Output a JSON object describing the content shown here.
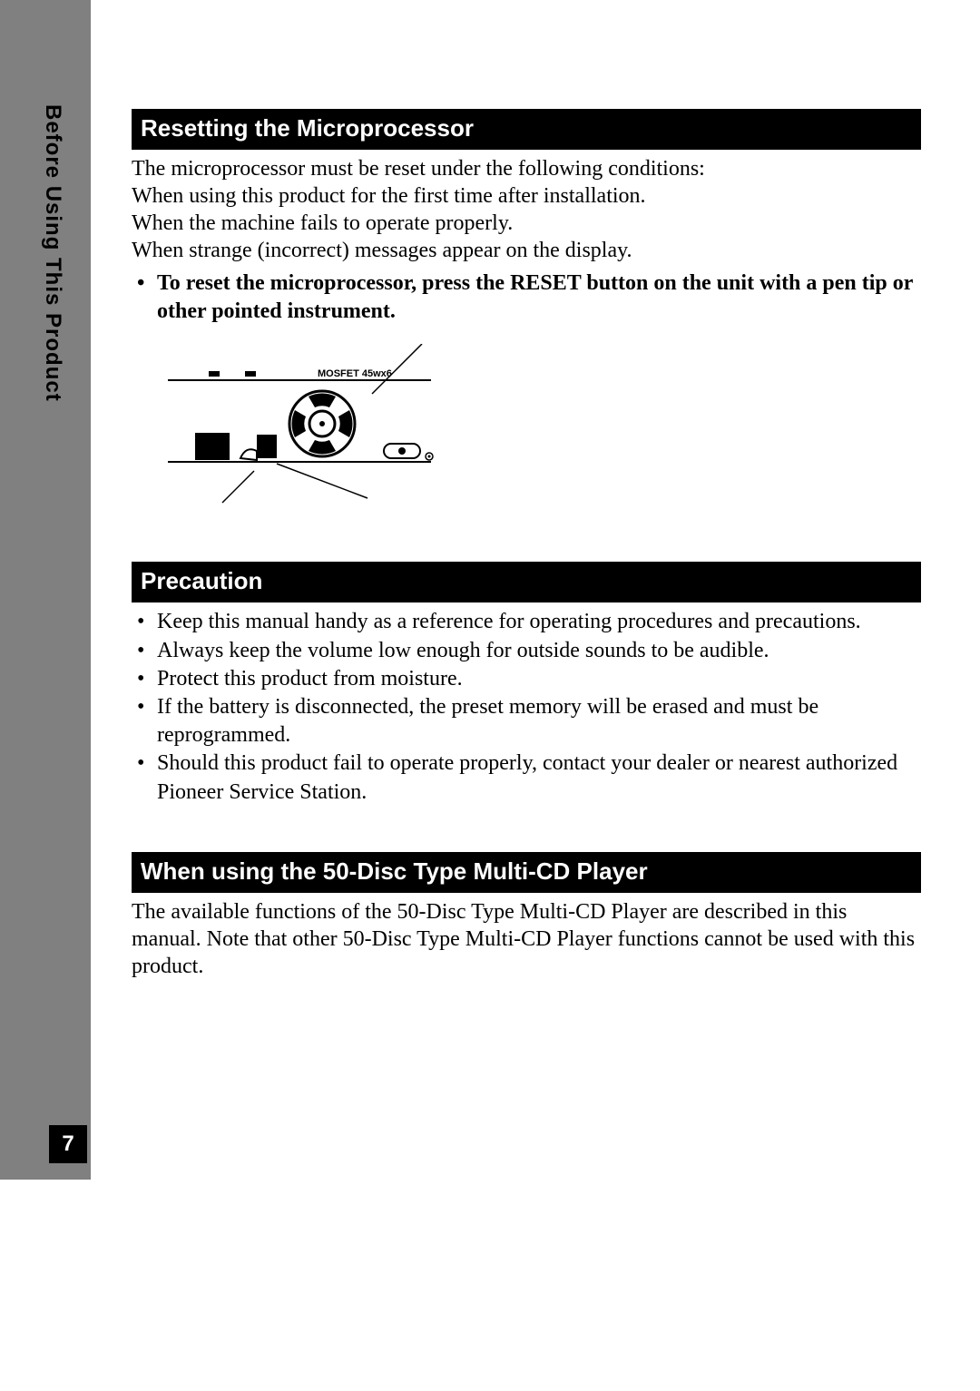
{
  "sidebar": {
    "section_label": "Before Using This Product",
    "page_number": "7"
  },
  "section1": {
    "heading": "Resetting the Microprocessor",
    "paragraph_lines": [
      "The microprocessor must be reset under the following conditions:",
      "When using this product for the first time after installation.",
      "When the machine fails to operate properly.",
      "When strange (incorrect) messages appear on the display."
    ],
    "instruction": "To reset the microprocessor, press the RESET button on the unit with a pen tip or other pointed instrument.",
    "figure_label": "MOSFET 45wx6"
  },
  "section2": {
    "heading": "Precaution",
    "bullets": [
      "Keep this manual handy as a reference for operating procedures and precautions.",
      "Always keep the volume low enough for outside sounds to be audible.",
      "Protect this product from moisture.",
      "If the battery is disconnected, the preset memory will be erased and must be reprogrammed.",
      "Should this product fail to operate properly, contact your dealer or nearest authorized Pioneer Service Station."
    ]
  },
  "section3": {
    "heading": "When using the 50-Disc Type Multi-CD Player",
    "paragraph": "The available functions of the 50-Disc Type Multi-CD Player are described in this manual. Note that other 50-Disc Type Multi-CD Player functions cannot be used with this product."
  }
}
